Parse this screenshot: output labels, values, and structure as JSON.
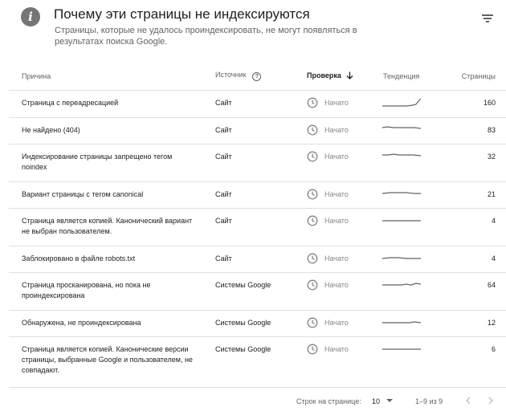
{
  "header": {
    "title": "Почему эти страницы не индексируются",
    "subtitle": "Страницы, которые не удалось проиндексировать, не могут появляться в результатах поиска Google."
  },
  "table": {
    "columns": {
      "reason": "Причина",
      "source": "Источник",
      "check": "Проверка",
      "trend": "Тенденция",
      "pages": "Страницы"
    },
    "rows": [
      {
        "reason": "Страница с переадресацией",
        "source": "Сайт",
        "status": "Начато",
        "pages": "160"
      },
      {
        "reason": "Не найдено (404)",
        "source": "Сайт",
        "status": "Начато",
        "pages": "83"
      },
      {
        "reason": "Индексирование страницы запрещено тегом noindex",
        "source": "Сайт",
        "status": "Начато",
        "pages": "32"
      },
      {
        "reason": "Вариант страницы с тегом canonical",
        "source": "Сайт",
        "status": "Начато",
        "pages": "21"
      },
      {
        "reason": "Страница является копией. Канонический вариант не выбран пользователем.",
        "source": "Сайт",
        "status": "Начато",
        "pages": "4"
      },
      {
        "reason": "Заблокировано в файле robots.txt",
        "source": "Сайт",
        "status": "Начато",
        "pages": "4"
      },
      {
        "reason": "Страница просканирована, но пока не проиндексирована",
        "source": "Системы Google",
        "status": "Начато",
        "pages": "64"
      },
      {
        "reason": "Обнаружена, не проиндексирована",
        "source": "Системы Google",
        "status": "Начато",
        "pages": "12"
      },
      {
        "reason": "Страница является копией. Канонические версии страницы, выбранные Google и пользователем, не совпадают.",
        "source": "Системы Google",
        "status": "Начато",
        "pages": "6"
      }
    ]
  },
  "footer": {
    "rows_label": "Строк на странице:",
    "rows_value": "10",
    "range": "1–9 из 9"
  },
  "colors": {
    "icon_gray": "#757575",
    "text_secondary": "#5f6368",
    "divider": "#e0e0e0"
  }
}
